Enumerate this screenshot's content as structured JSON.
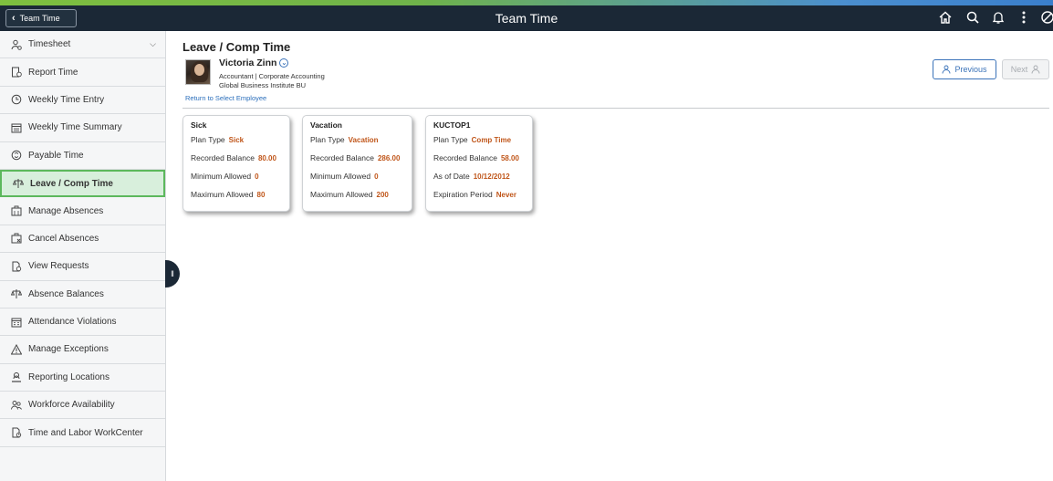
{
  "header": {
    "back_label": "Team Time",
    "title": "Team Time"
  },
  "sidebar": {
    "items": [
      {
        "label": "Timesheet",
        "icon": "person-clock-icon"
      },
      {
        "label": "Report Time",
        "icon": "report-icon"
      },
      {
        "label": "Weekly Time Entry",
        "icon": "clock-icon"
      },
      {
        "label": "Weekly Time Summary",
        "icon": "calendar-summary-icon"
      },
      {
        "label": "Payable Time",
        "icon": "payable-icon"
      },
      {
        "label": "Leave / Comp Time",
        "icon": "balance-icon"
      },
      {
        "label": "Manage Absences",
        "icon": "absence-icon"
      },
      {
        "label": "Cancel Absences",
        "icon": "cancel-absence-icon"
      },
      {
        "label": "View Requests",
        "icon": "requests-icon"
      },
      {
        "label": "Absence Balances",
        "icon": "balance-icon"
      },
      {
        "label": "Attendance Violations",
        "icon": "calendar-icon"
      },
      {
        "label": "Manage Exceptions",
        "icon": "warning-icon"
      },
      {
        "label": "Reporting Locations",
        "icon": "location-icon"
      },
      {
        "label": "Workforce Availability",
        "icon": "people-icon"
      },
      {
        "label": "Time and Labor WorkCenter",
        "icon": "workcenter-icon"
      }
    ]
  },
  "main": {
    "title": "Leave / Comp Time",
    "employee": {
      "name": "Victoria Zinn",
      "line1": "Accountant | Corporate Accounting",
      "line2": "Global Business Institute BU"
    },
    "return_link": "Return to Select Employee",
    "prev_label": "Previous",
    "next_label": "Next",
    "cards": [
      {
        "title": "Sick",
        "rows": [
          {
            "label": "Plan Type",
            "value": "Sick"
          },
          {
            "label": "Recorded Balance",
            "value": "80.00"
          },
          {
            "label": "Minimum Allowed",
            "value": "0"
          },
          {
            "label": "Maximum Allowed",
            "value": "80"
          }
        ]
      },
      {
        "title": "Vacation",
        "rows": [
          {
            "label": "Plan Type",
            "value": "Vacation"
          },
          {
            "label": "Recorded Balance",
            "value": "286.00"
          },
          {
            "label": "Minimum Allowed",
            "value": "0"
          },
          {
            "label": "Maximum Allowed",
            "value": "200"
          }
        ]
      },
      {
        "title": "KUCTOP1",
        "rows": [
          {
            "label": "Plan Type",
            "value": "Comp Time"
          },
          {
            "label": "Recorded Balance",
            "value": "58.00"
          },
          {
            "label": "As of Date",
            "value": "10/12/2012"
          },
          {
            "label": "Expiration Period",
            "value": "Never"
          }
        ]
      }
    ]
  },
  "colors": {
    "header_bg": "#1b2836",
    "active_bg": "#d8efdc",
    "active_border": "#5cb85c",
    "value_color": "#c0561a",
    "link_color": "#2a6ebb"
  }
}
